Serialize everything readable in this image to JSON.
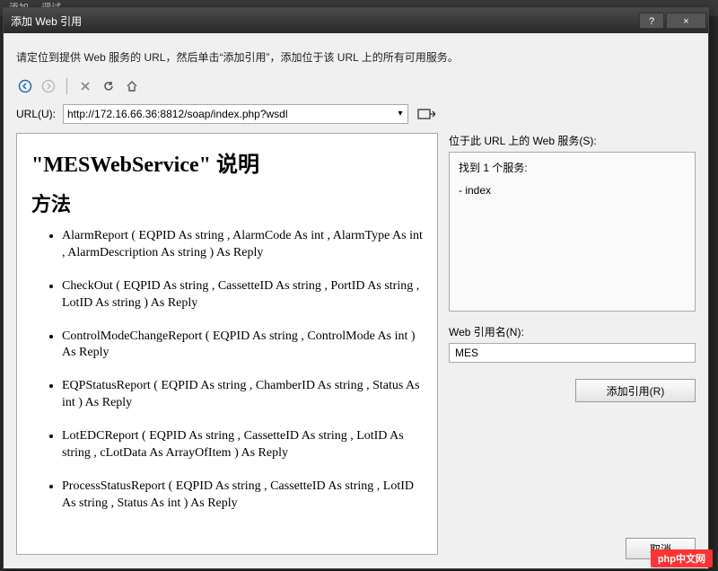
{
  "background_tab": "添加…  调试…",
  "dialog": {
    "title": "添加 Web 引用",
    "help_btn": "?",
    "close_btn": "×",
    "instruction": "请定位到提供 Web 服务的 URL，然后单击“添加引用”，添加位于该 URL 上的所有可用服务。",
    "url_label": "URL(U):",
    "url_value": "http://172.16.66.36:8812/soap/index.php?wsdl",
    "services_label": "位于此 URL 上的 Web 服务(S):",
    "services_found": "找到 1 个服务:",
    "services_item": "- index",
    "refname_label": "Web 引用名(N):",
    "refname_value": "MES",
    "add_btn": "添加引用(R)",
    "cancel_btn": "取消"
  },
  "preview": {
    "heading": "\"MESWebService\" 说明",
    "methods_label": "方法",
    "methods": [
      "AlarmReport ( EQPID As string ,  AlarmCode As int ,  AlarmType As int ,  AlarmDescription As string ) As Reply",
      "CheckOut ( EQPID As string ,  CassetteID As string ,  PortID As string ,  LotID As string ) As Reply",
      "ControlModeChangeReport ( EQPID As string ,  ControlMode As int ) As Reply",
      "EQPStatusReport ( EQPID As string ,  ChamberID As string ,  Status As int ) As Reply",
      "LotEDCReport ( EQPID As string ,  CassetteID As string ,  LotID As string ,  cLotData As ArrayOfItem ) As Reply",
      "ProcessStatusReport ( EQPID As string ,  CassetteID As string ,  LotID As string ,  Status As int ) As Reply"
    ]
  },
  "watermark": "php中文网"
}
